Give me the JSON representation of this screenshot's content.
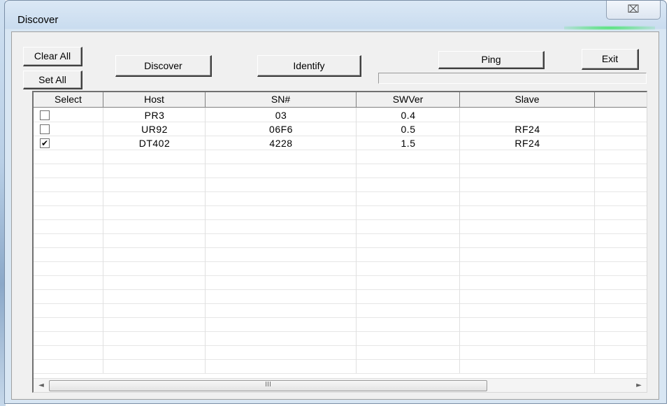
{
  "window": {
    "title": "Discover",
    "close_glyph": "⌧"
  },
  "toolbar": {
    "clear_all": "Clear All",
    "set_all": "Set All",
    "discover": "Discover",
    "identify": "Identify",
    "ping": "Ping",
    "exit": "Exit"
  },
  "table": {
    "columns": [
      "Select",
      "Host",
      "SN#",
      "SWVer",
      "Slave"
    ],
    "rows": [
      {
        "checked": false,
        "host": "PR3",
        "sn": "03",
        "swver": "0.4",
        "slave": ""
      },
      {
        "checked": false,
        "host": "UR92",
        "sn": "06F6",
        "swver": "0.5",
        "slave": "RF24"
      },
      {
        "checked": true,
        "host": "DT402",
        "sn": "4228",
        "swver": "1.5",
        "slave": "RF24"
      }
    ]
  },
  "scrollbar": {
    "left_arrow": "◄",
    "right_arrow": "►",
    "grip": "III"
  },
  "progress": {
    "value": 0
  }
}
